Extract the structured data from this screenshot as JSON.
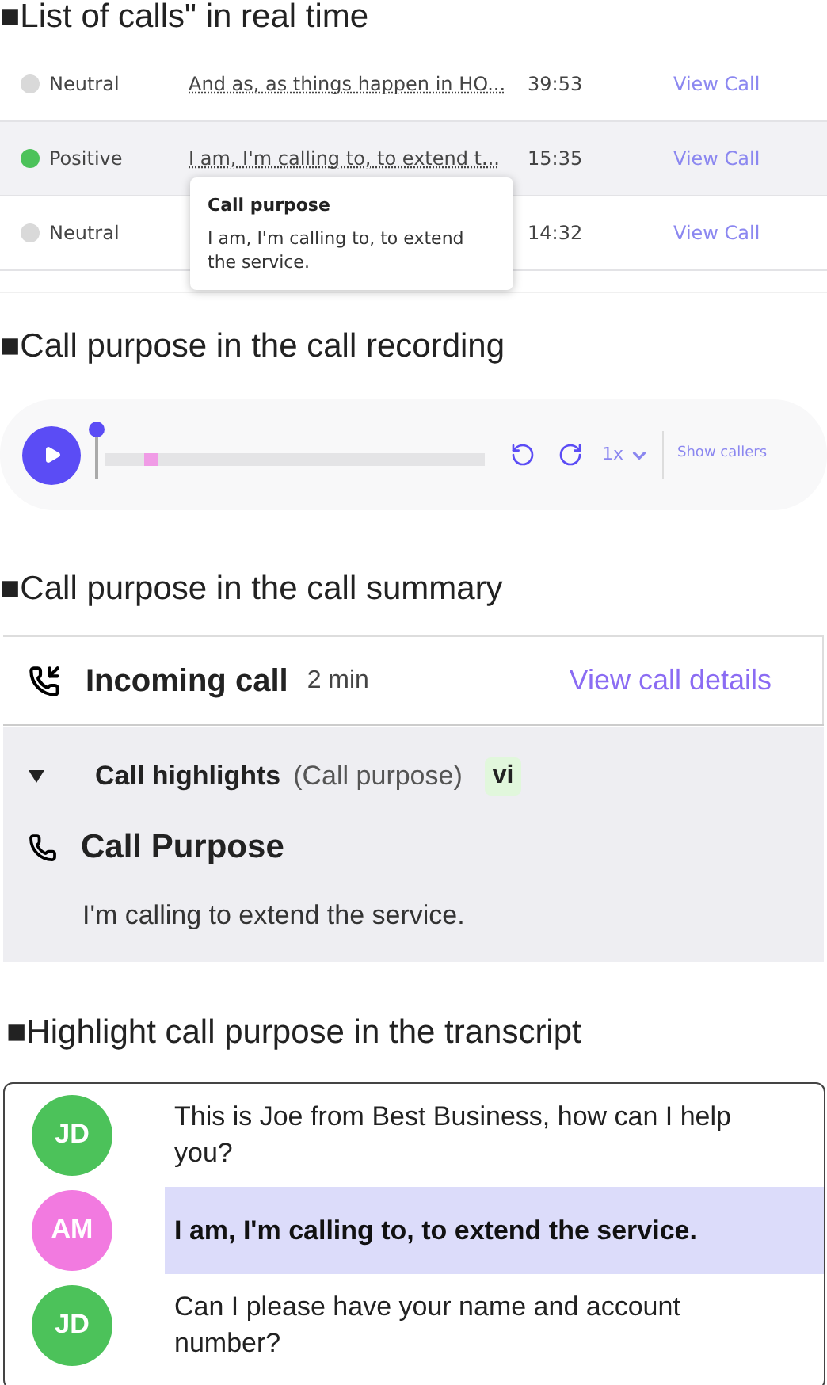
{
  "sections": [
    {
      "heading": "■List of calls\" in real time"
    },
    {
      "heading": "■Call purpose in the call recording"
    },
    {
      "heading": "■Call purpose in the call summary"
    },
    {
      "heading": "■Highlight call purpose in the transcript"
    }
  ],
  "calls": [
    {
      "sentiment": "Neutral",
      "color": "#d9d9d9",
      "snippet": "And as, as things happen in HO...",
      "duration": "39:53",
      "action": "View Call",
      "selected": false
    },
    {
      "sentiment": "Positive",
      "color": "#4cc25a",
      "snippet": "I am, I'm calling to, to extend t...",
      "duration": "15:35",
      "action": "View Call",
      "selected": true
    },
    {
      "sentiment": "Neutral",
      "color": "#d9d9d9",
      "duration": "14:32",
      "action": "View Call",
      "selected": false
    }
  ],
  "tooltip": {
    "title": "Call purpose",
    "text": "I am, I'm calling to, to extend the service."
  },
  "player": {
    "speed": "1x",
    "show_callers": "Show callers"
  },
  "summary": {
    "title": "Incoming call",
    "duration": "2 min",
    "link": "View call details",
    "highlights_title": "Call highlights",
    "highlights_note": "(Call purpose)",
    "badge": "vi",
    "expanded": true,
    "purpose_title": "Call Purpose",
    "purpose_text": "I'm calling to extend the service."
  },
  "transcript": [
    {
      "initials": "JD",
      "color": "#4cc25a",
      "text": "This is Joe from Best Business, how can I help you?",
      "highlighted": false
    },
    {
      "initials": "AM",
      "color": "#f27ae0",
      "text": "I am, I'm calling to, to extend the service.",
      "highlighted": true
    },
    {
      "initials": "JD",
      "color": "#4cc25a",
      "text": "Can I please have your name and account number?",
      "highlighted": false
    }
  ]
}
